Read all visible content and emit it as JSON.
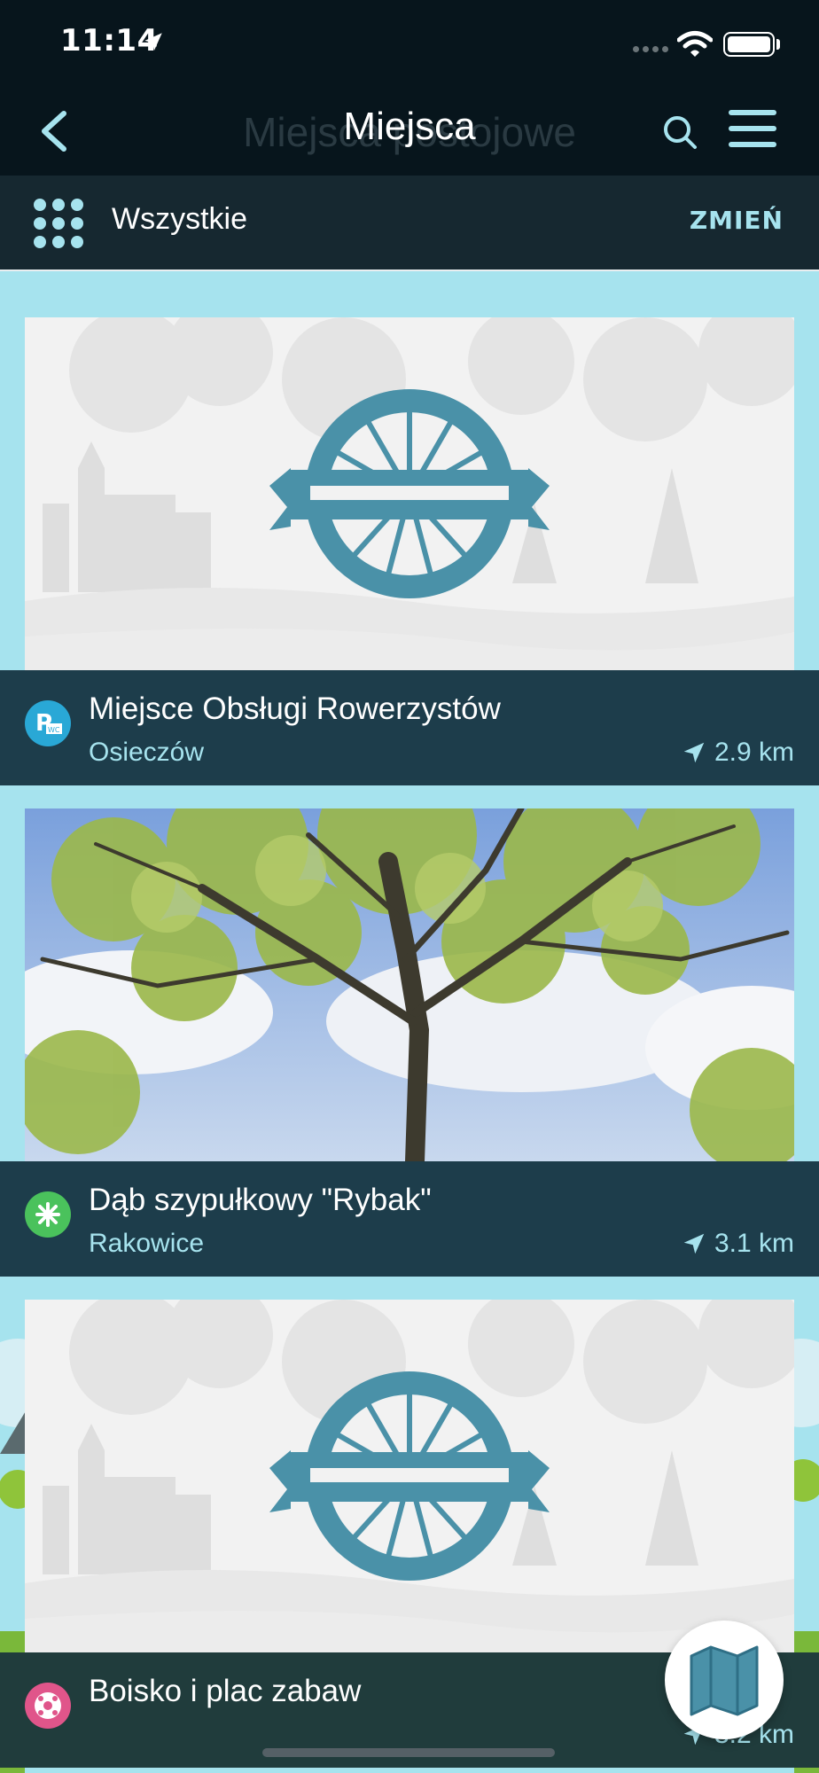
{
  "status_bar": {
    "time": "11:14"
  },
  "nav": {
    "title": "Miejsca",
    "ghost_title": "Miejsca postojowe"
  },
  "filter": {
    "label": "Wszystkie",
    "change_label": "ZMIEŃ"
  },
  "places": [
    {
      "title": "Miejsce Obsługi Rowerzystów",
      "town": "Osieczów",
      "distance": "2.9 km",
      "category_icon": "parking-wc-icon",
      "category_color": "#29a8d6"
    },
    {
      "title": "Dąb szypułkowy \"Rybak\"",
      "town": "Rakowice",
      "distance": "3.1 km",
      "category_icon": "nature-icon",
      "category_color": "#4ac25c"
    },
    {
      "title": "Boisko i plac zabaw",
      "town": "",
      "distance": "3.2 km",
      "category_icon": "ball-icon",
      "category_color": "#e0558a"
    }
  ],
  "colors": {
    "accent": "#a6e3ee",
    "header_bg": "#07151c",
    "info_bg": "#1d3d4b",
    "icon_blue": "#4a91a8"
  }
}
